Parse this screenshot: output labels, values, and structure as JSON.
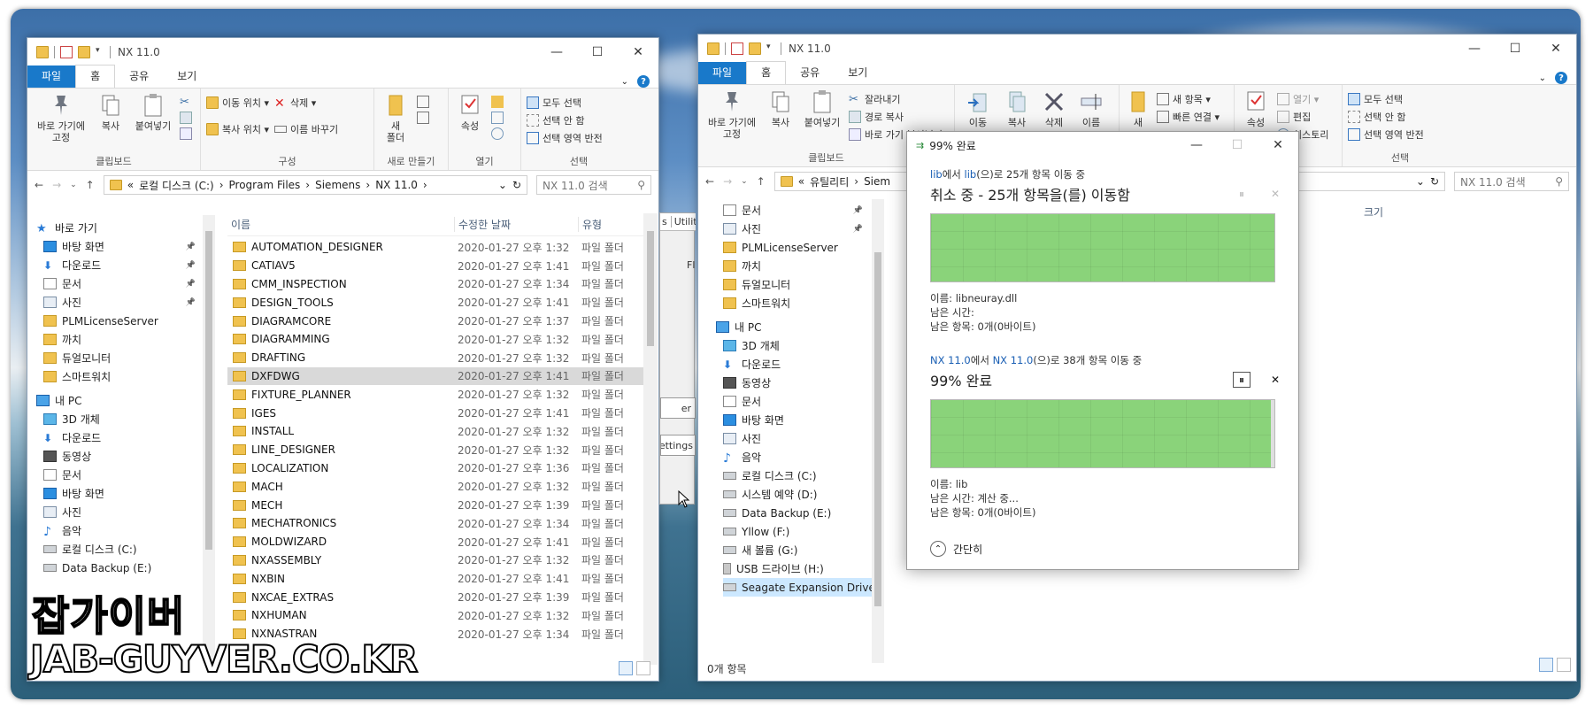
{
  "left_window": {
    "title": "NX 11.0",
    "tabs": [
      "파일",
      "홈",
      "공유",
      "보기"
    ],
    "ribbon": {
      "clipboard": {
        "pin": "바로 가기에\n고정",
        "copy": "복사",
        "paste": "붙여넣기",
        "label": "클립보드"
      },
      "organize": {
        "move": "이동 위치 ▾",
        "copyto": "복사 위치 ▾",
        "delete": "삭제 ▾",
        "rename": "이름 바꾸기",
        "label": "구성"
      },
      "new": {
        "folder": "새\n폴더",
        "label": "새로 만들기"
      },
      "open": {
        "props": "속성",
        "label": "열기"
      },
      "select": {
        "all": "모두 선택",
        "none": "선택 안 함",
        "invert": "선택 영역 반전",
        "label": "선택"
      }
    },
    "address": {
      "path": [
        "«",
        "로컬 디스크 (C:)",
        "›",
        "Program Files",
        "›",
        "Siemens",
        "›",
        "NX 11.0",
        "›"
      ],
      "search_placeholder": "NX 11.0 검색"
    },
    "nav": [
      {
        "label": "바로 가기",
        "icon": "star-icon",
        "pin": false
      },
      {
        "label": "바탕 화면",
        "icon": "desktop-icon",
        "pin": true
      },
      {
        "label": "다운로드",
        "icon": "download-icon",
        "pin": true
      },
      {
        "label": "문서",
        "icon": "document-icon",
        "pin": true
      },
      {
        "label": "사진",
        "icon": "picture-icon",
        "pin": true
      },
      {
        "label": "PLMLicenseServer",
        "icon": "folder-icon",
        "pin": false
      },
      {
        "label": "까치",
        "icon": "folder-icon",
        "pin": false
      },
      {
        "label": "듀얼모니터",
        "icon": "folder-icon",
        "pin": false
      },
      {
        "label": "스마트워치",
        "icon": "folder-icon",
        "pin": false
      },
      {
        "label": "내 PC",
        "icon": "pc-icon",
        "pin": false
      },
      {
        "label": "3D 개체",
        "icon": "cube-icon",
        "pin": false
      },
      {
        "label": "다운로드",
        "icon": "download-icon",
        "pin": false
      },
      {
        "label": "동영상",
        "icon": "video-icon",
        "pin": false
      },
      {
        "label": "문서",
        "icon": "document-icon",
        "pin": false
      },
      {
        "label": "바탕 화면",
        "icon": "desktop-icon",
        "pin": false
      },
      {
        "label": "사진",
        "icon": "picture-icon",
        "pin": false
      },
      {
        "label": "음악",
        "icon": "music-icon",
        "pin": false
      },
      {
        "label": "로컬 디스크 (C:)",
        "icon": "drive-icon",
        "pin": false
      },
      {
        "label": "Data Backup (E:)",
        "icon": "drive-icon",
        "pin": false
      }
    ],
    "columns": {
      "name": "이름",
      "date": "수정한 날짜",
      "type": "유형"
    },
    "files": [
      {
        "name": "AUTOMATION_DESIGNER",
        "date": "2020-01-27 오후 1:32",
        "type": "파일 폴더"
      },
      {
        "name": "CATIAV5",
        "date": "2020-01-27 오후 1:41",
        "type": "파일 폴더"
      },
      {
        "name": "CMM_INSPECTION",
        "date": "2020-01-27 오후 1:34",
        "type": "파일 폴더"
      },
      {
        "name": "DESIGN_TOOLS",
        "date": "2020-01-27 오후 1:41",
        "type": "파일 폴더"
      },
      {
        "name": "DIAGRAMCORE",
        "date": "2020-01-27 오후 1:37",
        "type": "파일 폴더"
      },
      {
        "name": "DIAGRAMMING",
        "date": "2020-01-27 오후 1:32",
        "type": "파일 폴더"
      },
      {
        "name": "DRAFTING",
        "date": "2020-01-27 오후 1:32",
        "type": "파일 폴더"
      },
      {
        "name": "DXFDWG",
        "date": "2020-01-27 오후 1:41",
        "type": "파일 폴더"
      },
      {
        "name": "FIXTURE_PLANNER",
        "date": "2020-01-27 오후 1:32",
        "type": "파일 폴더"
      },
      {
        "name": "IGES",
        "date": "2020-01-27 오후 1:41",
        "type": "파일 폴더"
      },
      {
        "name": "INSTALL",
        "date": "2020-01-27 오후 1:32",
        "type": "파일 폴더"
      },
      {
        "name": "LINE_DESIGNER",
        "date": "2020-01-27 오후 1:32",
        "type": "파일 폴더"
      },
      {
        "name": "LOCALIZATION",
        "date": "2020-01-27 오후 1:36",
        "type": "파일 폴더"
      },
      {
        "name": "MACH",
        "date": "2020-01-27 오후 1:32",
        "type": "파일 폴더"
      },
      {
        "name": "MECH",
        "date": "2020-01-27 오후 1:39",
        "type": "파일 폴더"
      },
      {
        "name": "MECHATRONICS",
        "date": "2020-01-27 오후 1:34",
        "type": "파일 폴더"
      },
      {
        "name": "MOLDWIZARD",
        "date": "2020-01-27 오후 1:41",
        "type": "파일 폴더"
      },
      {
        "name": "NXASSEMBLY",
        "date": "2020-01-27 오후 1:32",
        "type": "파일 폴더"
      },
      {
        "name": "NXBIN",
        "date": "2020-01-27 오후 1:41",
        "type": "파일 폴더"
      },
      {
        "name": "NXCAE_EXTRAS",
        "date": "2020-01-27 오후 1:39",
        "type": "파일 폴더"
      },
      {
        "name": "NXHUMAN",
        "date": "2020-01-27 오후 1:32",
        "type": "파일 폴더"
      },
      {
        "name": "NXNASTRAN",
        "date": "2020-01-27 오후 1:34",
        "type": "파일 폴더"
      }
    ],
    "selected_index": 7
  },
  "right_window": {
    "title": "NX 11.0",
    "tabs": [
      "파일",
      "홈",
      "공유",
      "보기"
    ],
    "ribbon": {
      "pin": "바로 가기에\n고정",
      "copy": "복사",
      "paste": "붙여넣기",
      "cut": "잘라내기",
      "copypath": "경로 복사",
      "pasteshortcut": "바로 가기 붙여넣기",
      "clipboard_label": "클립보드",
      "moveto": "이동",
      "copyto": "복사",
      "delete": "삭제",
      "rename": "이름",
      "newfolder": "새",
      "newitem": "새 항목 ▾",
      "quickaccess": "빠른 연결 ▾",
      "props": "속성",
      "open": "열기 ▾",
      "edit": "편집",
      "history": "히스토리",
      "open_label": "열기",
      "selectall": "모두 선택",
      "selectnone": "선택 안 함",
      "invert": "선택 영역 반전",
      "select_label": "선택"
    },
    "address": {
      "path": [
        "«",
        "유틸리티",
        "›",
        "Siem"
      ],
      "search_placeholder": "NX 11.0 검색"
    },
    "nav": [
      {
        "label": "문서",
        "icon": "document-icon",
        "pin": true
      },
      {
        "label": "사진",
        "icon": "picture-icon",
        "pin": true
      },
      {
        "label": "PLMLicenseServer",
        "icon": "folder-icon",
        "pin": false
      },
      {
        "label": "까치",
        "icon": "folder-icon",
        "pin": false
      },
      {
        "label": "듀얼모니터",
        "icon": "folder-icon",
        "pin": false
      },
      {
        "label": "스마트워치",
        "icon": "folder-icon",
        "pin": false
      },
      {
        "label": "내 PC",
        "icon": "pc-icon",
        "pin": false
      },
      {
        "label": "3D 개체",
        "icon": "cube-icon",
        "pin": false
      },
      {
        "label": "다운로드",
        "icon": "download-icon",
        "pin": false
      },
      {
        "label": "동영상",
        "icon": "video-icon",
        "pin": false
      },
      {
        "label": "문서",
        "icon": "document-icon",
        "pin": false
      },
      {
        "label": "바탕 화면",
        "icon": "desktop-icon",
        "pin": false
      },
      {
        "label": "사진",
        "icon": "picture-icon",
        "pin": false
      },
      {
        "label": "음악",
        "icon": "music-icon",
        "pin": false
      },
      {
        "label": "로컬 디스크 (C:)",
        "icon": "drive-icon",
        "pin": false
      },
      {
        "label": "시스템 예약 (D:)",
        "icon": "drive-icon",
        "pin": false
      },
      {
        "label": "Data Backup (E:)",
        "icon": "drive-icon",
        "pin": false
      },
      {
        "label": "Yllow (F:)",
        "icon": "drive-icon",
        "pin": false
      },
      {
        "label": "새 볼륨 (G:)",
        "icon": "drive-icon",
        "pin": false
      },
      {
        "label": "USB 드라이브 (H:)",
        "icon": "usb-icon",
        "pin": false
      },
      {
        "label": "Seagate Expansion Drive (J",
        "icon": "drive-icon",
        "pin": false
      }
    ],
    "size_col": "크기",
    "status": "0개 항목"
  },
  "behind_window": {
    "tab1": "s",
    "tab2": "Utilitie",
    "label_fl": "Fl",
    "btn_er": "er",
    "btn_settings": "settings"
  },
  "dialog": {
    "title": "99% 완료",
    "op1": {
      "from": "lib",
      "mid": "에서 ",
      "to": "lib",
      "tail": "(으)로 25개 항목 이동 중",
      "heading": "취소 중 - 25개 항목을(를) 이동함",
      "progress": 100,
      "name": "이름: libneuray.dll",
      "remaining_time": "남은 시간:",
      "remaining_items": "남은 항목: 0개(0바이트)"
    },
    "op2": {
      "from": "NX 11.0",
      "mid": "에서 ",
      "to": "NX 11.0",
      "tail": "(으)로 38개 항목 이동 중",
      "heading": "99% 완료",
      "progress": 99,
      "name": "이름: lib",
      "remaining_time": "남은 시간: 계산 중...",
      "remaining_items": "남은 항목: 0개(0바이트)"
    },
    "less": "간단히"
  },
  "watermark": {
    "line1": "잡가이버",
    "line2": "JAB-GUYVER.CO.KR"
  },
  "colors": {
    "accent": "#1979ca",
    "progress": "#8ad37a",
    "folder": "#f0c24f"
  }
}
